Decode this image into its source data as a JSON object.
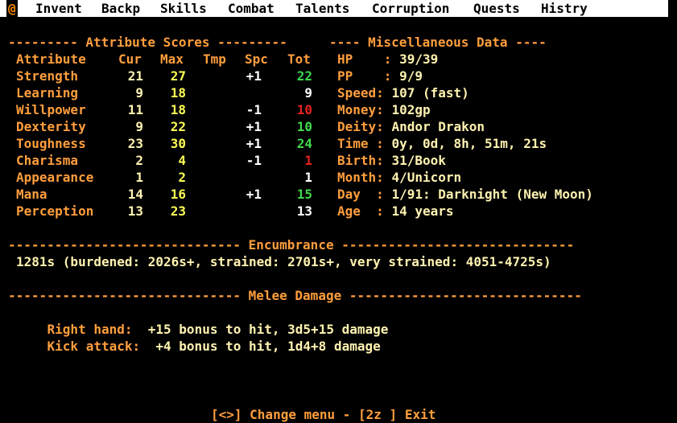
{
  "tabs": {
    "at": "@",
    "items": [
      "Invent",
      "Backp",
      "Skills",
      "Combat",
      "Talents",
      "Corruption",
      "Quests",
      "Histry"
    ]
  },
  "attributes": {
    "header_rule": "--------- Attribute Scores ---------",
    "columns": [
      "Attribute",
      "Cur",
      "Max",
      "Tmp",
      "Spc",
      "Tot"
    ],
    "rows": [
      {
        "name": "Strength",
        "cur": "21",
        "max": "27",
        "tmp": "",
        "spc": "+1",
        "tot": "22"
      },
      {
        "name": "Learning",
        "cur": "9",
        "max": "18",
        "tmp": "",
        "spc": "",
        "tot": "9"
      },
      {
        "name": "Willpower",
        "cur": "11",
        "max": "18",
        "tmp": "",
        "spc": "-1",
        "tot": "10"
      },
      {
        "name": "Dexterity",
        "cur": "9",
        "max": "22",
        "tmp": "",
        "spc": "+1",
        "tot": "10"
      },
      {
        "name": "Toughness",
        "cur": "23",
        "max": "30",
        "tmp": "",
        "spc": "+1",
        "tot": "24"
      },
      {
        "name": "Charisma",
        "cur": "2",
        "max": "4",
        "tmp": "",
        "spc": "-1",
        "tot": "1"
      },
      {
        "name": "Appearance",
        "cur": "1",
        "max": "2",
        "tmp": "",
        "spc": "",
        "tot": "1"
      },
      {
        "name": "Mana",
        "cur": "14",
        "max": "16",
        "tmp": "",
        "spc": "+1",
        "tot": "15"
      },
      {
        "name": "Perception",
        "cur": "13",
        "max": "23",
        "tmp": "",
        "spc": "",
        "tot": "13"
      }
    ]
  },
  "misc": {
    "header_rule": "---- Miscellaneous Data ----",
    "rows": [
      {
        "label": "HP    : ",
        "value": "39/39"
      },
      {
        "label": "PP    : ",
        "value": "9/9"
      },
      {
        "label": "Speed: ",
        "value": "107 (fast)"
      },
      {
        "label": "Money: ",
        "value": "102gp"
      },
      {
        "label": "Deity: ",
        "value": "Andor Drakon"
      },
      {
        "label": "Time : ",
        "value": "0y, 0d, 8h, 51m, 21s"
      },
      {
        "label": "Birth: ",
        "value": "31/Book"
      },
      {
        "label": "Month: ",
        "value": "4/Unicorn"
      },
      {
        "label": "Day  : ",
        "value": "1/91: Darknight (New Moon)"
      },
      {
        "label": "Age  : ",
        "value": "14 years"
      }
    ]
  },
  "encumbrance": {
    "header_rule": "------------------------------ Encumbrance ------------------------------",
    "text": "1281s (burdened: 2026s+, strained: 2701s+, very strained: 4051-4725s)"
  },
  "melee": {
    "header_rule": "------------------------------ Melee Damage ------------------------------",
    "lines": [
      {
        "label": "Right hand:  ",
        "value": "+15 bonus to hit, 3d5+15 damage"
      },
      {
        "label": "Kick attack:  ",
        "value": "+4 bonus to hit, 1d4+8 damage"
      }
    ]
  },
  "footer": {
    "text": "[<>] Change menu - [2z ] Exit"
  },
  "colors": {
    "background": "#000000",
    "tabbar": "#ffffff",
    "label": "#ff9e3d",
    "value": "#fff3b0",
    "max": "#ffff55",
    "good": "#3ed84a",
    "bad": "#e52020",
    "neutral": "#ffffff"
  }
}
